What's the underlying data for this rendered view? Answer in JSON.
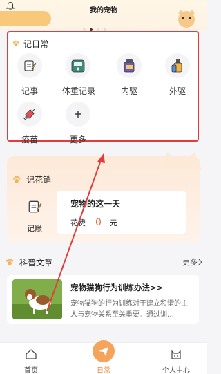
{
  "header": {
    "title": "我的宠物"
  },
  "daily": {
    "title": "记日常",
    "items": [
      {
        "label": "记事",
        "icon": "notepad-icon"
      },
      {
        "label": "体重记录",
        "icon": "scale-icon"
      },
      {
        "label": "内驱",
        "icon": "medicine-bottle-icon"
      },
      {
        "label": "外驱",
        "icon": "spray-bottle-icon"
      },
      {
        "label": "疫苗",
        "icon": "syringe-icon"
      },
      {
        "label": "更多",
        "icon": "plus-icon"
      }
    ]
  },
  "expense": {
    "title": "记花销",
    "ledger_label": "记账",
    "day_title": "宠物的这一天",
    "cost_label": "花费",
    "cost_value": "0",
    "unit": "元"
  },
  "articles": {
    "title": "科普文章",
    "more_label": "更多",
    "items": [
      {
        "title": "宠物猫狗行为训练办法>>",
        "desc": "宠物猫狗的行为训练对于建立和谐的主人与宠物关系至关重要。通过训…"
      }
    ]
  },
  "tabbar": {
    "home": "首页",
    "daily": "日常",
    "profile": "个人中心"
  },
  "colors": {
    "accent": "#f5a55b",
    "highlight_border": "#e23b3b",
    "cost": "#e86a4b"
  }
}
